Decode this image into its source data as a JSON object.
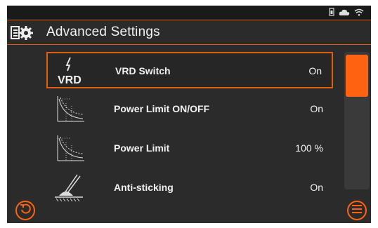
{
  "header": {
    "title": "Advanced Settings",
    "title_icon": "settings-gear-icon"
  },
  "status_icons": [
    "battery-icon",
    "cloud-icon",
    "wifi-icon"
  ],
  "settings": [
    {
      "icon": "vrd-icon",
      "icon_text": "VRD",
      "label": "VRD Switch",
      "value": "On",
      "selected": true
    },
    {
      "icon": "power-limit-curve-icon",
      "label": "Power Limit ON/OFF",
      "value": "On",
      "selected": false
    },
    {
      "icon": "power-limit-curve-icon",
      "label": "Power Limit",
      "value": "100 %",
      "selected": false
    },
    {
      "icon": "anti-sticking-icon",
      "label": "Anti-sticking",
      "value": "On",
      "selected": false
    }
  ],
  "scroll": {
    "thumb_fraction": 0.3
  },
  "footer": {
    "left_button_icon": "back-icon",
    "right_button_icon": "menu-icon"
  },
  "colors": {
    "accent": "#ff6310",
    "background": "#2b2b2b",
    "text": "#f2f2f2"
  }
}
